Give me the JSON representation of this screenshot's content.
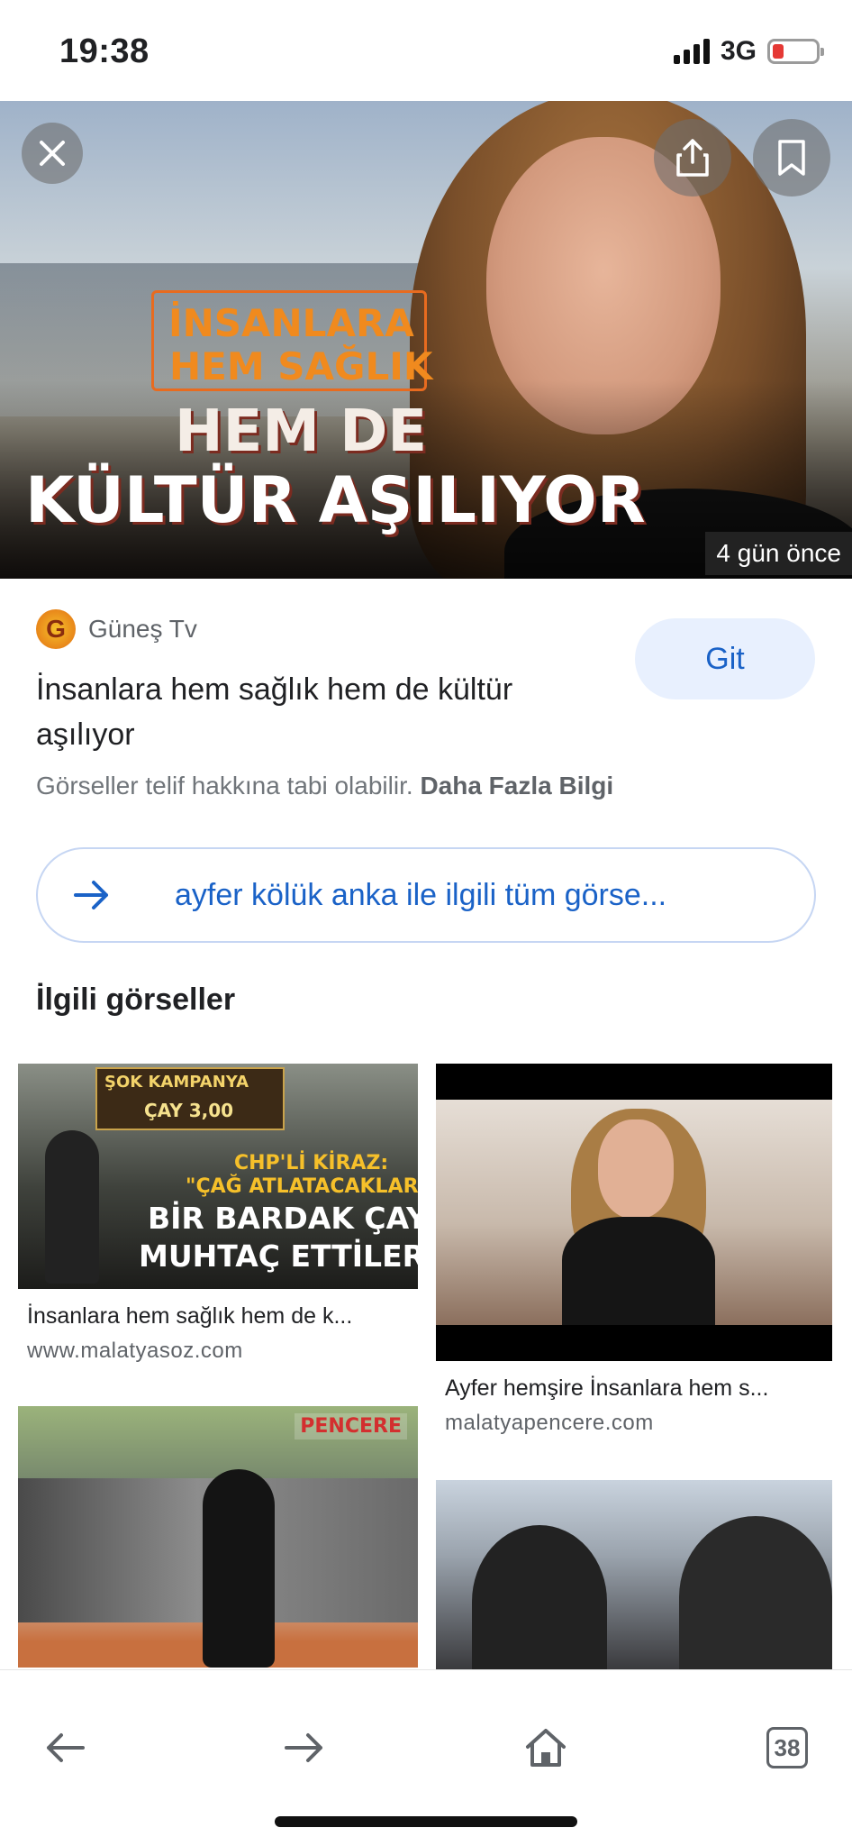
{
  "status_bar": {
    "time": "19:38",
    "network": "3G"
  },
  "hero": {
    "overlay_line1": "İNSANLARA",
    "overlay_line2": "HEM SAĞLIK",
    "overlay_line3": "HEM DE",
    "overlay_line4": "KÜLTÜR AŞILIYOR",
    "time_badge": "4 gün önce",
    "icons": [
      "close-icon",
      "share-icon",
      "bookmark-icon"
    ]
  },
  "result": {
    "source_name": "Güneş Tv",
    "source_logo_letter": "G",
    "title": "İnsanlara hem sağlık hem de kültür aşılıyor",
    "visit_button": "Git",
    "copyright_text": "Görseller telif hakkına tabi olabilir.",
    "copyright_link": "Daha Fazla Bilgi"
  },
  "search_all": {
    "label": "ayfer kölük anka ile ilgili tüm görse..."
  },
  "related": {
    "title": "İlgili görseller",
    "items": [
      {
        "caption": "İnsanlara hem sağlık hem de k...",
        "domain": "www.malatyasoz.com",
        "thumb_sign": "ŞOK KAMPANYA",
        "thumb_sign2": "ÇAY 3,00",
        "thumb_line1": "CHP'Lİ KİRAZ:",
        "thumb_line2": "\"ÇAĞ ATLATACAKLARDI",
        "thumb_line3": "BİR BARDAK ÇAYA",
        "thumb_line4": "MUHTAÇ ETTİLER\""
      },
      {
        "caption": "Ayfer hemşire İnsanlara hem s...",
        "domain": "malatyapencere.com"
      },
      {
        "caption": "",
        "domain": "",
        "thumb_logo": "PENCERE"
      },
      {
        "caption": "",
        "domain": ""
      }
    ]
  },
  "bottom_bar": {
    "tab_count": "38",
    "icons": [
      "back-arrow-icon",
      "forward-arrow-icon",
      "home-icon",
      "tabs-icon"
    ]
  },
  "colors": {
    "accent": "#1a62c7",
    "pill_bg": "#e8f0fe",
    "battery_low": "#e53935"
  }
}
